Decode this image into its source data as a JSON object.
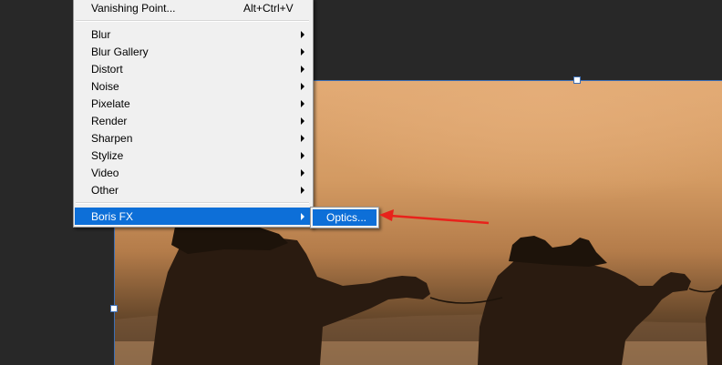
{
  "menu": {
    "top_item": {
      "label": "Vanishing Point...",
      "shortcut": "Alt+Ctrl+V"
    },
    "filters": [
      {
        "label": "Blur",
        "has_submenu": true
      },
      {
        "label": "Blur Gallery",
        "has_submenu": true
      },
      {
        "label": "Distort",
        "has_submenu": true
      },
      {
        "label": "Noise",
        "has_submenu": true
      },
      {
        "label": "Pixelate",
        "has_submenu": true
      },
      {
        "label": "Render",
        "has_submenu": true
      },
      {
        "label": "Sharpen",
        "has_submenu": true
      },
      {
        "label": "Stylize",
        "has_submenu": true
      },
      {
        "label": "Video",
        "has_submenu": true
      },
      {
        "label": "Other",
        "has_submenu": true
      }
    ],
    "plugin": {
      "label": "Boris FX",
      "has_submenu": true,
      "highlighted": true
    }
  },
  "submenu": {
    "items": [
      {
        "label": "Optics...",
        "highlighted": true
      }
    ]
  },
  "colors": {
    "highlight": "#0d6fd8",
    "menu_bg": "#f0f0f0",
    "workspace_bg": "#282828",
    "annotation_arrow": "#e8221b"
  }
}
